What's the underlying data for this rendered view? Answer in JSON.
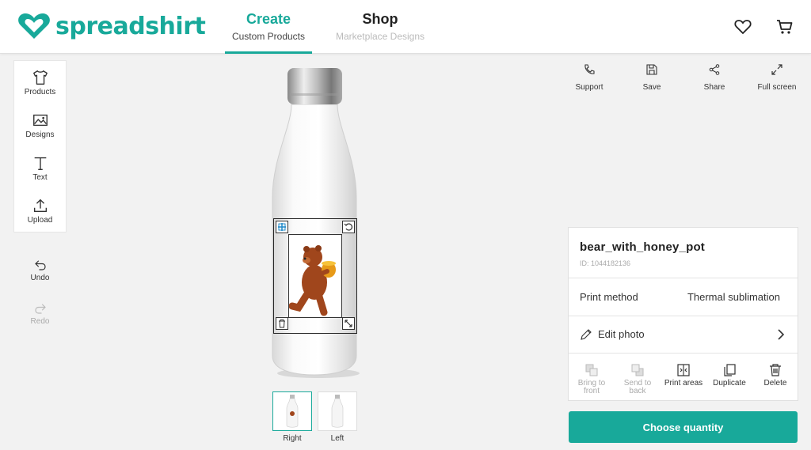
{
  "header": {
    "brand": "spreadshirt",
    "tabs": [
      {
        "title": "Create",
        "subtitle": "Custom Products"
      },
      {
        "title": "Shop",
        "subtitle": "Marketplace Designs"
      }
    ],
    "icons": [
      "heart-icon",
      "cart-icon"
    ]
  },
  "tools": [
    {
      "label": "Products",
      "icon": "tshirt-icon"
    },
    {
      "label": "Designs",
      "icon": "image-icon"
    },
    {
      "label": "Text",
      "icon": "text-icon"
    },
    {
      "label": "Upload",
      "icon": "upload-icon"
    }
  ],
  "history": {
    "undo": "Undo",
    "redo": "Redo"
  },
  "top_actions": [
    {
      "label": "Support",
      "icon": "phone-icon"
    },
    {
      "label": "Save",
      "icon": "save-icon"
    },
    {
      "label": "Share",
      "icon": "share-icon"
    },
    {
      "label": "Full screen",
      "icon": "fullscreen-icon"
    }
  ],
  "views": [
    {
      "label": "Right",
      "active": true
    },
    {
      "label": "Left",
      "active": false
    }
  ],
  "design_panel": {
    "name": "bear_with_honey_pot",
    "id_text": "ID: 1044182136",
    "print_method_label": "Print method",
    "print_method_value": "Thermal sublimation",
    "edit_photo": "Edit photo",
    "actions": [
      {
        "label": "Bring to front",
        "enabled": false
      },
      {
        "label": "Send to back",
        "enabled": false
      },
      {
        "label": "Print areas",
        "enabled": true
      },
      {
        "label": "Duplicate",
        "enabled": true
      },
      {
        "label": "Delete",
        "enabled": true
      }
    ]
  },
  "cta": "Choose quantity",
  "colors": {
    "accent": "#18a99a",
    "disabled": "#aaaaaa"
  }
}
